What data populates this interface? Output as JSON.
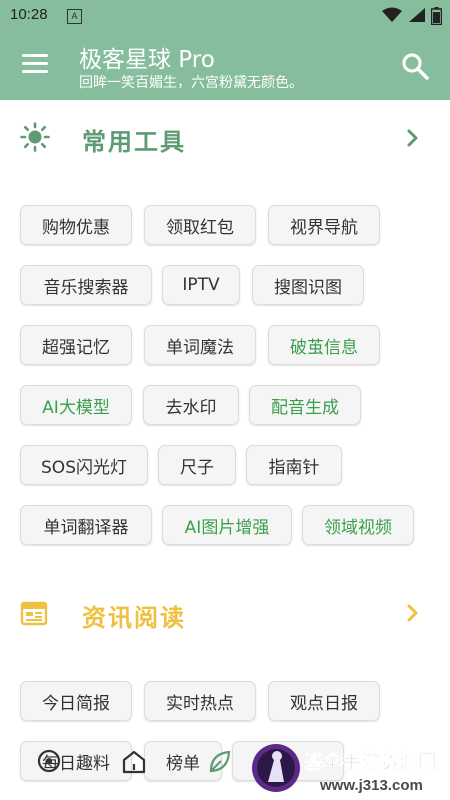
{
  "status_bar": {
    "time": "10:28",
    "badge": "A"
  },
  "app_bar": {
    "title": "极客星球 Pro",
    "subtitle": "回眸一笑百媚生，六宫粉黛无颜色。",
    "menu_icon": "menu-icon",
    "search_icon": "search-icon",
    "color": "#86bd9c"
  },
  "sections": {
    "tools": {
      "title": "常用工具",
      "icon": "sun-icon",
      "color": "#5e9a73",
      "chips": [
        {
          "label": "购物优惠",
          "accent": false
        },
        {
          "label": "领取红包",
          "accent": false
        },
        {
          "label": "视界导航",
          "accent": false
        },
        {
          "label": "音乐搜索器",
          "accent": false
        },
        {
          "label": "IPTV",
          "accent": false
        },
        {
          "label": "搜图识图",
          "accent": false
        },
        {
          "label": "超强记忆",
          "accent": false
        },
        {
          "label": "单词魔法",
          "accent": false
        },
        {
          "label": "破茧信息",
          "accent": true
        },
        {
          "label": "AI大模型",
          "accent": true
        },
        {
          "label": "去水印",
          "accent": false
        },
        {
          "label": "配音生成",
          "accent": true
        },
        {
          "label": "SOS闪光灯",
          "accent": false
        },
        {
          "label": "尺子",
          "accent": false
        },
        {
          "label": "指南针",
          "accent": false
        },
        {
          "label": "单词翻译器",
          "accent": false
        },
        {
          "label": "AI图片增强",
          "accent": true
        },
        {
          "label": "领域视频",
          "accent": true
        }
      ]
    },
    "news": {
      "title": "资讯阅读",
      "icon": "calendar-icon",
      "color": "#f0c040",
      "chips": [
        {
          "label": "今日简报"
        },
        {
          "label": "实时热点"
        },
        {
          "label": "观点日报"
        },
        {
          "label": "每日趣料"
        },
        {
          "label": "榜单"
        }
      ]
    }
  },
  "accent_green": "#3aa04e",
  "watermark": {
    "text": "基伞手游资源网",
    "url_text": "www.j313.com"
  }
}
